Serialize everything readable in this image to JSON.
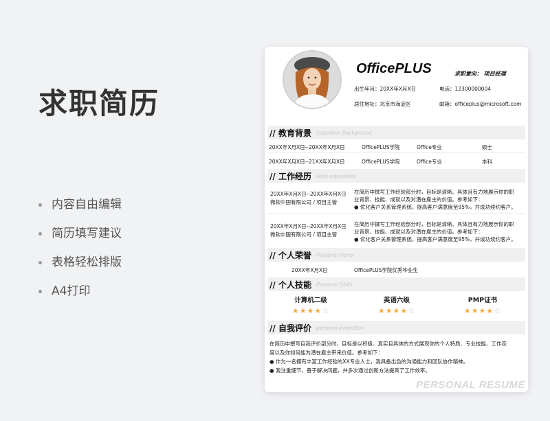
{
  "slide": {
    "title": "求职简历",
    "bullets": [
      "内容自由编辑",
      "简历填写建议",
      "表格轻松排版",
      "A4打印"
    ]
  },
  "resume": {
    "name": "OfficePLUS",
    "intent": "求职意向：  项目经理",
    "birth": "出生年月：20XX年X月X日",
    "phone": "电话：12300000004",
    "address": "居住地址：北京市海淀区",
    "email": "邮箱：officeplus@microsoft.com",
    "sections": {
      "education": {
        "title": "// 教育背景",
        "en": "Education Background"
      },
      "work": {
        "title": "// 工作经历",
        "en": "work experience"
      },
      "honor": {
        "title": "// 个人荣誉",
        "en": "Personal Honor"
      },
      "skills": {
        "title": "// 个人技能",
        "en": "Personal Skills"
      },
      "evaluation": {
        "title": "// 自我评价",
        "en": "personal evaluation"
      }
    },
    "education": [
      {
        "period": "20XX年X月X日--20XX年X月X日",
        "school": "OfficePLUS学院",
        "major": "Office专业",
        "degree": "硕士"
      },
      {
        "period": "20XX年X月X日--21XX年X月X日",
        "school": "OfficePLUS学院",
        "major": "Office专业",
        "degree": "本科"
      }
    ],
    "work": [
      {
        "period": "20XX年X月X日--20XX年X月X日",
        "company": "微软中国有限公司 / 项目主管",
        "desc1": "在简历中撰写工作经验部分时，目标是清晰、具体且有力地展示你的职",
        "desc2": "业背景、技能、成就以及对潜在雇主的价值。参考如下：",
        "desc3": "● 优化客户关系管理系统，提高客户满意度至95%，并成功续约客户。"
      },
      {
        "period": "20XX年X月X日--20XX年X月X日",
        "company": "微软中国有限公司 / 项目主管",
        "desc1": "在简历中撰写工作经验部分时，目标是清晰、具体且有力地展示你的职",
        "desc2": "业背景、技能、成就以及对潜在雇主的价值。参考如下：",
        "desc3": "● 优化客户关系管理系统，提高客户满意度至95%，并成功续约客户。"
      }
    ],
    "honor": {
      "date": "20XX年X月X日",
      "desc": "OfficePLUS学院优秀毕业生"
    },
    "skills": [
      {
        "name": "计算机二级",
        "stars_on": "★★★★",
        "stars_off": "☆",
        "rating": 4
      },
      {
        "name": "英语六级",
        "stars_on": "★★★★",
        "stars_off": "☆",
        "rating": 4
      },
      {
        "name": "PMP证书",
        "stars_on": "★★★★",
        "stars_off": "☆",
        "rating": 4
      }
    ],
    "evaluation": [
      "在简历中撰写自我评价部分时，目标是以积极、真实且具体的方式展现你的个人特质、专业技能、工作态",
      "度以及你如何能为潜在雇主带来价值。参考如下：",
      "● 作为一名拥有丰富工作经验的XX专业人士，我具备出色的沟通能力和团队协作精神。",
      "● 我注重细节，善于解决问题，并多次通过创新方法提高了工作效率。"
    ],
    "watermark": "PERSONAL  RESUME"
  },
  "colors": {
    "star": "#f2a93b",
    "section_bg": "#f0f0f0",
    "title": "#333333"
  }
}
